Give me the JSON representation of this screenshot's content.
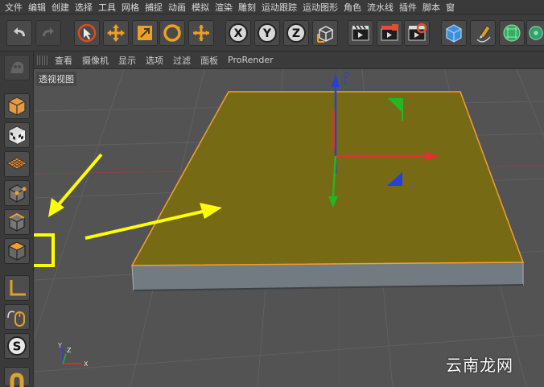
{
  "menu": {
    "items": [
      "文件",
      "编辑",
      "创建",
      "选择",
      "工具",
      "网格",
      "捕捉",
      "动画",
      "模拟",
      "渲染",
      "雕刻",
      "运动跟踪",
      "运动图形",
      "角色",
      "流水线",
      "插件",
      "脚本",
      "窗"
    ]
  },
  "toolbar": {
    "axis_x": "X",
    "axis_y": "Y",
    "axis_z": "Z"
  },
  "viewport_menu": {
    "items": [
      "查看",
      "摄像机",
      "显示",
      "选项",
      "过滤",
      "面板",
      "ProRender"
    ]
  },
  "viewport": {
    "label": "透视视图"
  },
  "watermark": "云南龙网",
  "colors": {
    "plane_top": "#766a14",
    "plane_edge": "#f0a030",
    "highlight": "#ffff00",
    "axis_x": "#e03030",
    "axis_y": "#22b822",
    "axis_z": "#2a3fd8"
  }
}
